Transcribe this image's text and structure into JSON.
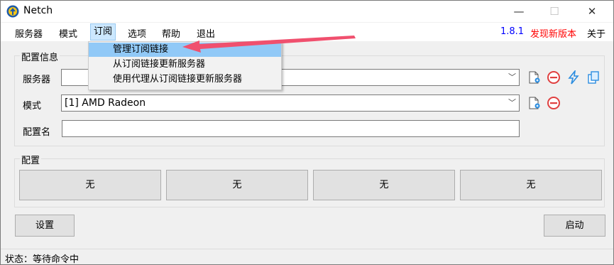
{
  "window": {
    "title": "Netch",
    "minimize_icon": "minimize-icon",
    "maximize_icon": "maximize-icon",
    "close_icon": "close-icon"
  },
  "menu": {
    "items": [
      "服务器",
      "模式",
      "订阅",
      "选项",
      "帮助",
      "退出"
    ],
    "version": "1.8.1",
    "new_version": "发现新版本",
    "about": "关于"
  },
  "dropdown": {
    "items": [
      "管理订阅链接",
      "从订阅链接更新服务器",
      "使用代理从订阅链接更新服务器"
    ]
  },
  "config_info": {
    "group_label": "配置信息",
    "server_label": "服务器",
    "server_value": "",
    "mode_label": "模式",
    "mode_value": "[1] AMD Radeon",
    "profile_name_label": "配置名",
    "profile_name_value": ""
  },
  "profiles": {
    "group_label": "配置",
    "buttons": [
      "无",
      "无",
      "无",
      "无"
    ]
  },
  "actions": {
    "settings": "设置",
    "start": "启动"
  },
  "status": {
    "text": "状态：等待命令中"
  },
  "colors": {
    "version": "#0000ff",
    "new_version": "#ff0000",
    "annotation_arrow": "#f0506e",
    "menu_highlight": "#91c9f7"
  }
}
